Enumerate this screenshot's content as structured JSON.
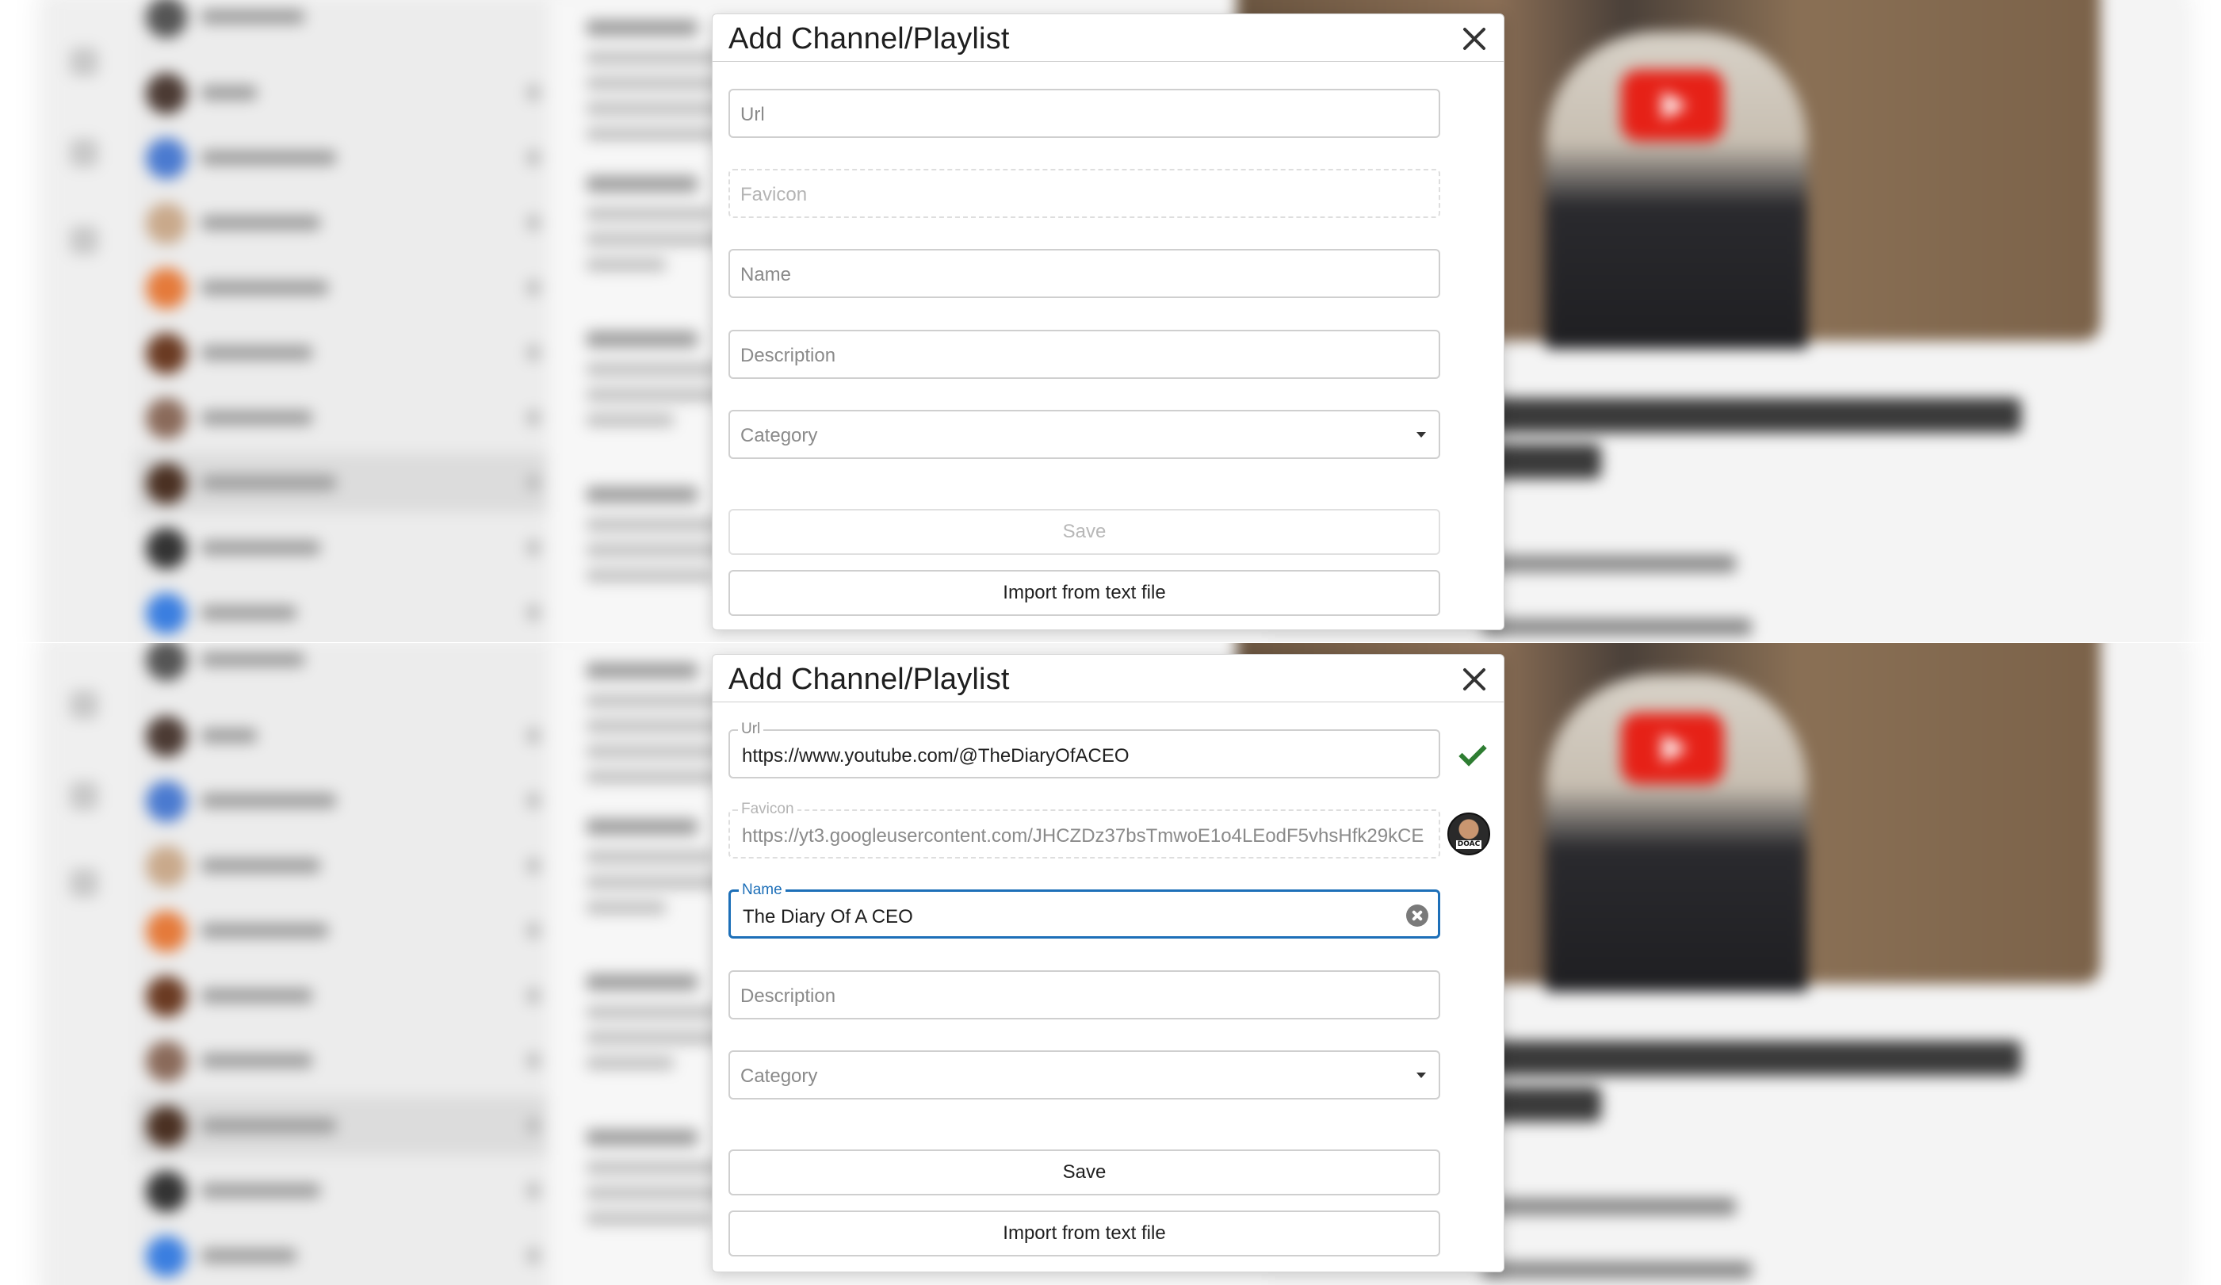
{
  "colors": {
    "accent": "#1d6fb8",
    "success": "#2e7d32",
    "youtube_red": "#e62117"
  },
  "icons": {
    "close": "close-icon",
    "valid": "check-icon",
    "clear": "clear-input-icon",
    "dropdown": "chevron-down-icon",
    "favicon_preview": "channel-avatar"
  },
  "modal_empty": {
    "title": "Add Channel/Playlist",
    "url_placeholder": "Url",
    "favicon_placeholder": "Favicon",
    "name_placeholder": "Name",
    "description_placeholder": "Description",
    "category_placeholder": "Category",
    "save_label": "Save",
    "save_disabled": true,
    "import_label": "Import from text file"
  },
  "modal_filled": {
    "title": "Add Channel/Playlist",
    "url_label": "Url",
    "url_value": "https://www.youtube.com/@TheDiaryOfACEO",
    "url_valid": true,
    "favicon_label": "Favicon",
    "favicon_value": "https://yt3.googleusercontent.com/JHCZDz37bsTmwoE1o4LEodF5vhsHfk29kCE",
    "favicon_badge": "DOAC",
    "name_label": "Name",
    "name_value": "The Diary Of A CEO",
    "description_placeholder": "Description",
    "category_placeholder": "Category",
    "save_label": "Save",
    "save_disabled": false,
    "import_label": "Import from text file"
  }
}
